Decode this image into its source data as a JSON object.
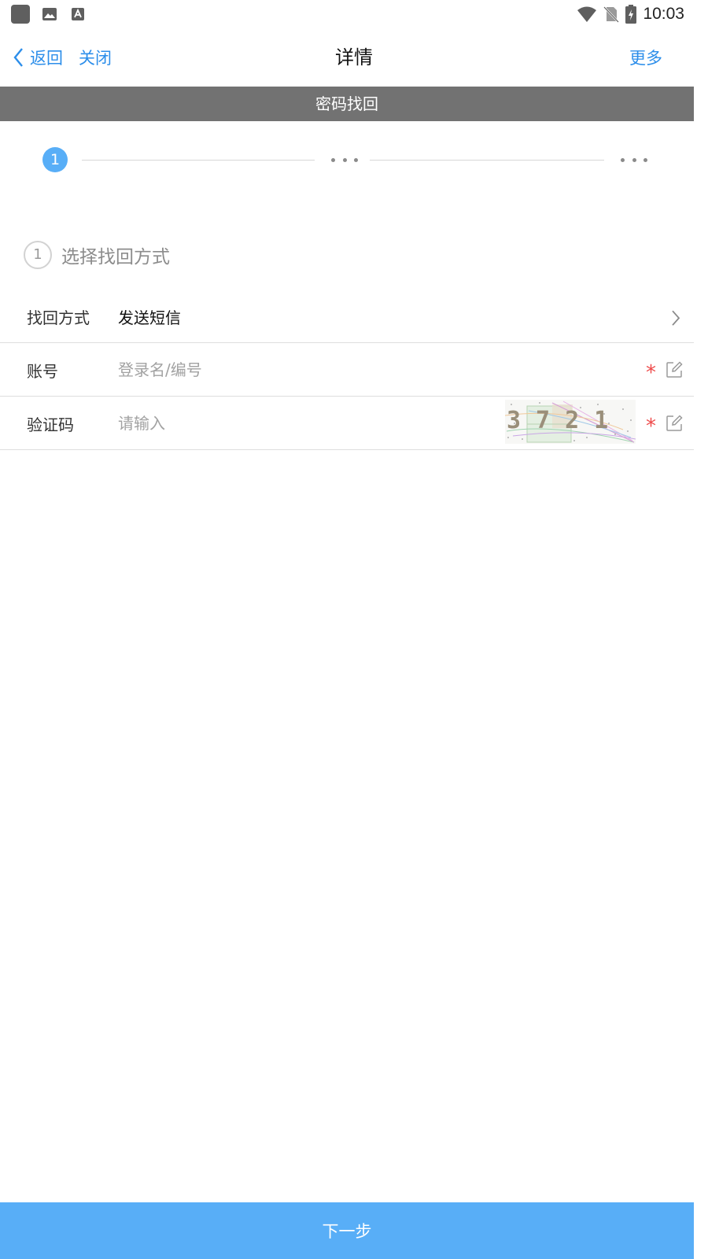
{
  "status_bar": {
    "time": "10:03",
    "icons": [
      "app-icon",
      "image-icon",
      "font-download-icon",
      "wifi-icon",
      "no-sim-icon",
      "battery-charging-icon"
    ]
  },
  "nav": {
    "back_label": "返回",
    "close_label": "关闭",
    "title": "详情",
    "more_label": "更多"
  },
  "banner": {
    "title": "密码找回"
  },
  "stepper": {
    "current_step": "1"
  },
  "step_heading": {
    "number": "1",
    "text": "选择找回方式"
  },
  "form": {
    "method": {
      "label": "找回方式",
      "value": "发送短信"
    },
    "account": {
      "label": "账号",
      "placeholder": "登录名/编号",
      "required_mark": "*"
    },
    "captcha": {
      "label": "验证码",
      "placeholder": "请输入",
      "required_mark": "*",
      "code": "3721"
    }
  },
  "actions": {
    "next_label": "下一步"
  },
  "colors": {
    "accent": "#58aef7",
    "link": "#2c8eea",
    "banner": "#727272",
    "required": "#ee4b4b"
  }
}
